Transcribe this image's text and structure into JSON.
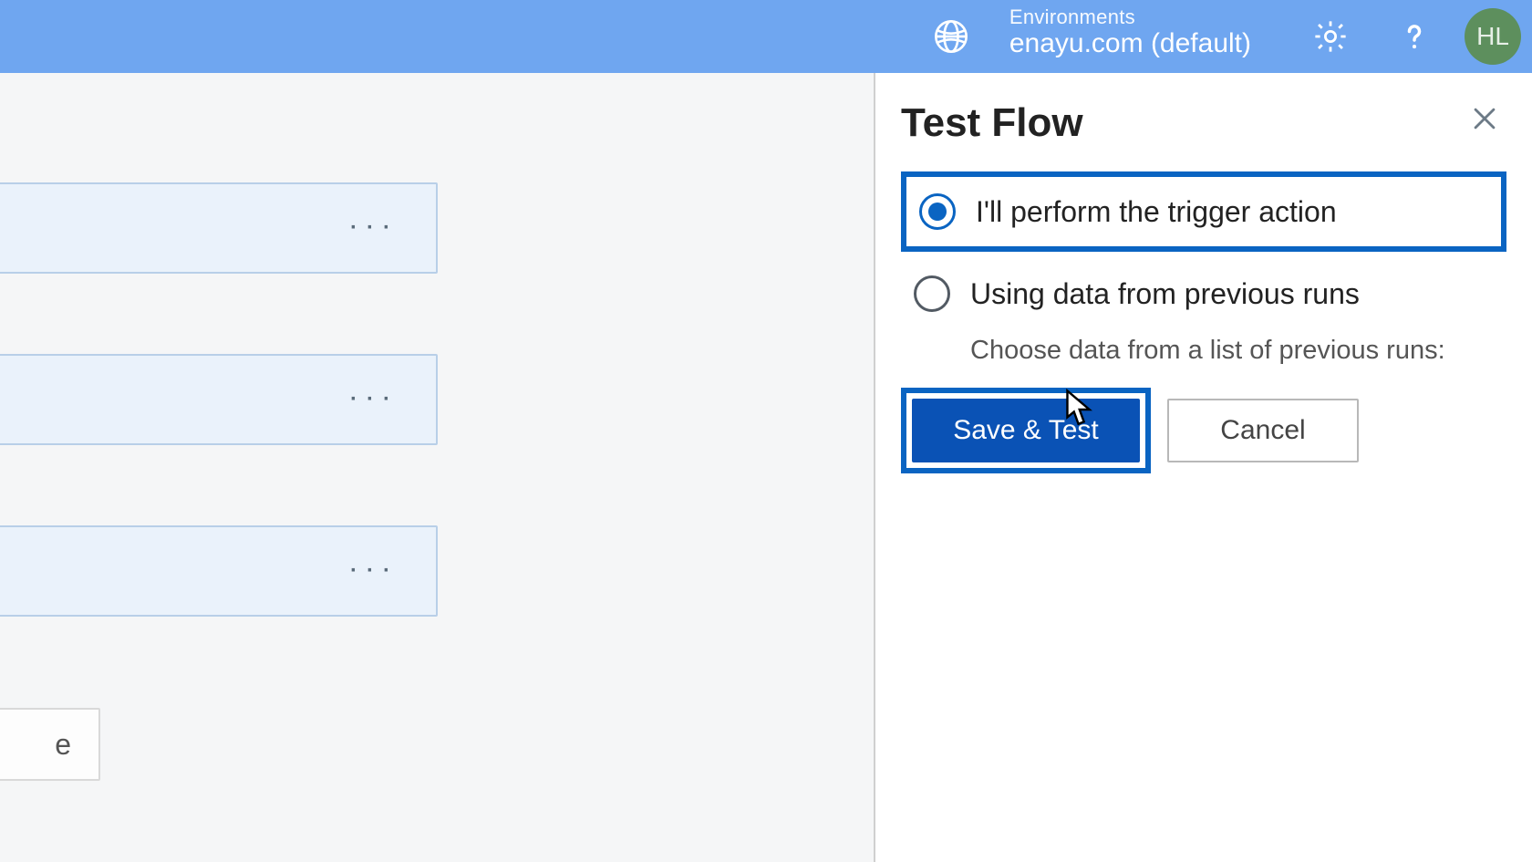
{
  "header": {
    "env_label": "Environments",
    "env_name": "enayu.com (default)",
    "avatar_initials": "HL"
  },
  "canvas": {
    "add_step_tail": "e"
  },
  "panel": {
    "title": "Test Flow",
    "option_perform": "I'll perform the trigger action",
    "option_previous": "Using data from previous runs",
    "option_previous_sub": "Choose data from a list of previous runs:",
    "save_test_label": "Save & Test",
    "cancel_label": "Cancel"
  }
}
